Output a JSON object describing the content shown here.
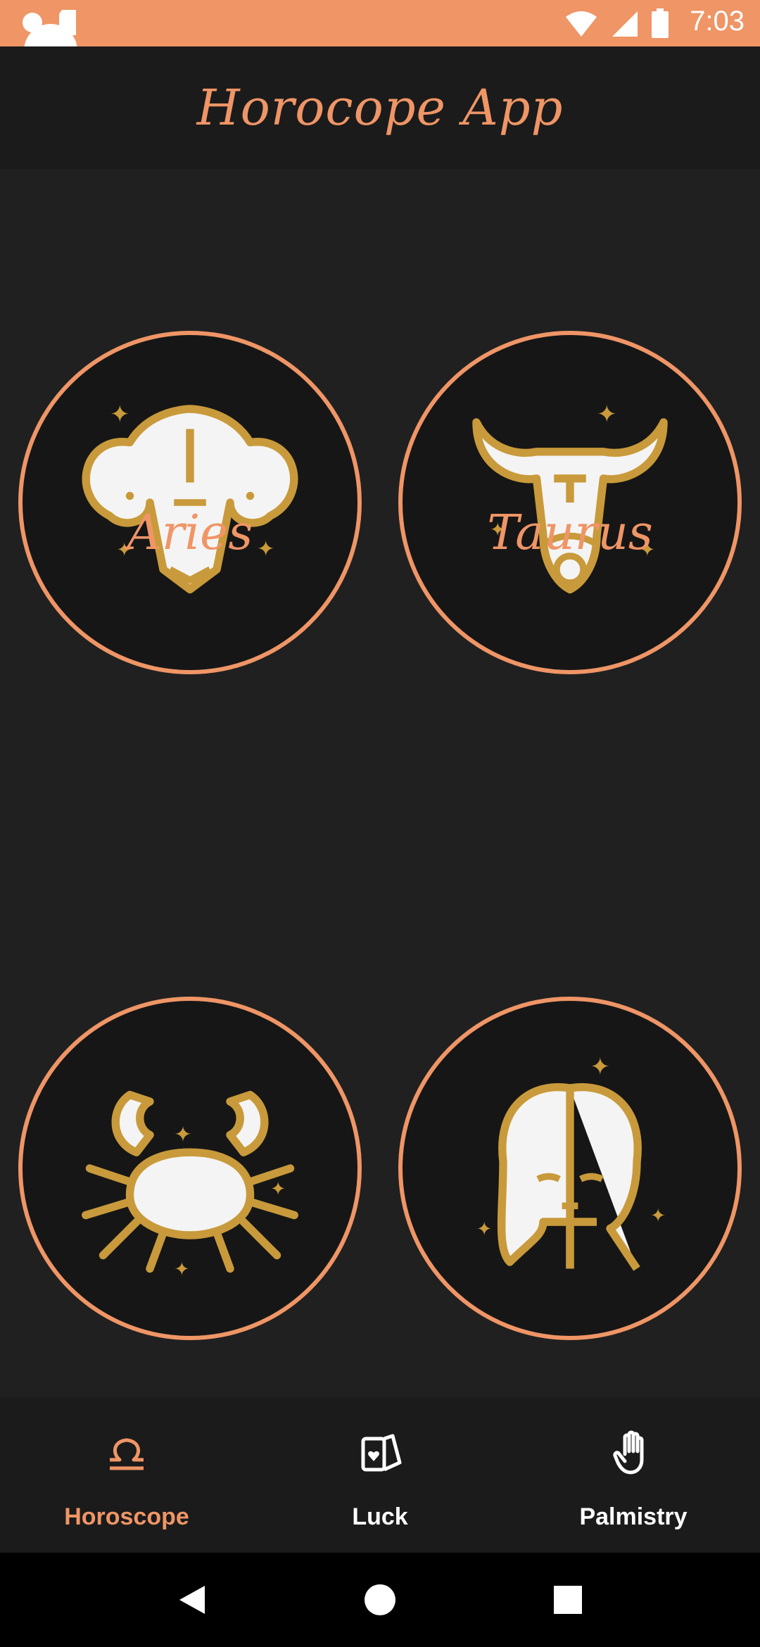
{
  "status_bar": {
    "time": "7:03"
  },
  "app_bar": {
    "title": "Horocope App"
  },
  "signs": [
    {
      "name": "Aries"
    },
    {
      "name": "Taurus"
    },
    {
      "name": "Cancer"
    },
    {
      "name": "Virgo"
    }
  ],
  "bottom_nav": {
    "items": [
      {
        "label": "Horoscope",
        "icon": "libra-icon",
        "active": true
      },
      {
        "label": "Luck",
        "icon": "cards-icon",
        "active": false
      },
      {
        "label": "Palmistry",
        "icon": "hand-icon",
        "active": false
      }
    ]
  },
  "colors": {
    "accent": "#EF9566",
    "gold": "#C99A3B",
    "background": "#202020",
    "bar": "#1b1b1b"
  }
}
